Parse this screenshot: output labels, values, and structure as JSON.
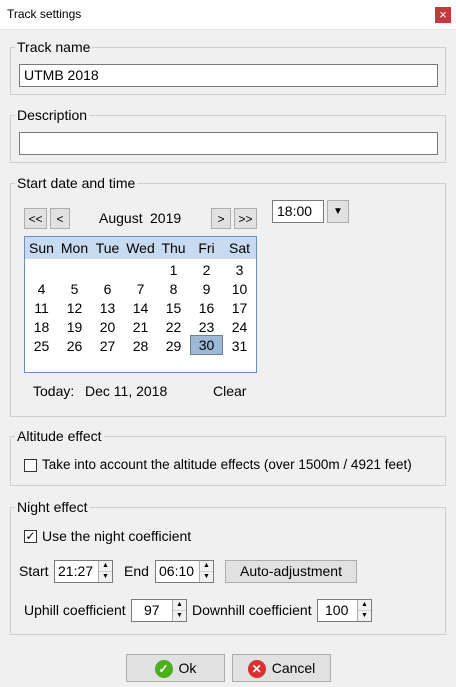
{
  "window": {
    "title": "Track settings",
    "close_glyph": "×"
  },
  "track_name": {
    "legend": "Track name",
    "value": "UTMB 2018"
  },
  "description": {
    "legend": "Description",
    "value": ""
  },
  "start": {
    "legend": "Start date and time",
    "nav": {
      "prev_year": "<<",
      "prev_month": "<",
      "next_month": ">",
      "next_year": ">>"
    },
    "month": "August",
    "year": "2019",
    "time": "18:00",
    "dropdown_glyph": "▼",
    "weekdays": [
      "Sun",
      "Mon",
      "Tue",
      "Wed",
      "Thu",
      "Fri",
      "Sat"
    ],
    "weeks": [
      [
        "",
        "",
        "",
        "",
        "1",
        "2",
        "3"
      ],
      [
        "4",
        "5",
        "6",
        "7",
        "8",
        "9",
        "10"
      ],
      [
        "11",
        "12",
        "13",
        "14",
        "15",
        "16",
        "17"
      ],
      [
        "18",
        "19",
        "20",
        "21",
        "22",
        "23",
        "24"
      ],
      [
        "25",
        "26",
        "27",
        "28",
        "29",
        "30",
        "31"
      ]
    ],
    "selected_day": "30",
    "today_label": "Today:",
    "today_value": "Dec 11, 2018",
    "clear_label": "Clear"
  },
  "altitude": {
    "legend": "Altitude effect",
    "checkbox_label": "Take into account the altitude effects (over 1500m / 4921 feet)",
    "checked": false
  },
  "night": {
    "legend": "Night effect",
    "checkbox_label": "Use the night coefficient",
    "checked": true,
    "start_label": "Start",
    "start_value": "21:27",
    "end_label": "End",
    "end_value": "06:10",
    "auto_label": "Auto-adjustment",
    "uphill_label": "Uphill coefficient",
    "uphill_value": "97",
    "downhill_label": "Downhill coefficient",
    "downhill_value": "100"
  },
  "buttons": {
    "ok": "Ok",
    "cancel": "Cancel"
  },
  "colors": {
    "calendar_header": "#c8daf0",
    "selected_day": "#9eb8d8",
    "close": "#c8373b",
    "ok_icon": "#4caf1e",
    "cancel_icon": "#d93030"
  },
  "icons": {
    "ok": "checkmark-icon",
    "cancel": "x-icon",
    "spinner": "spin-arrows-icon"
  }
}
